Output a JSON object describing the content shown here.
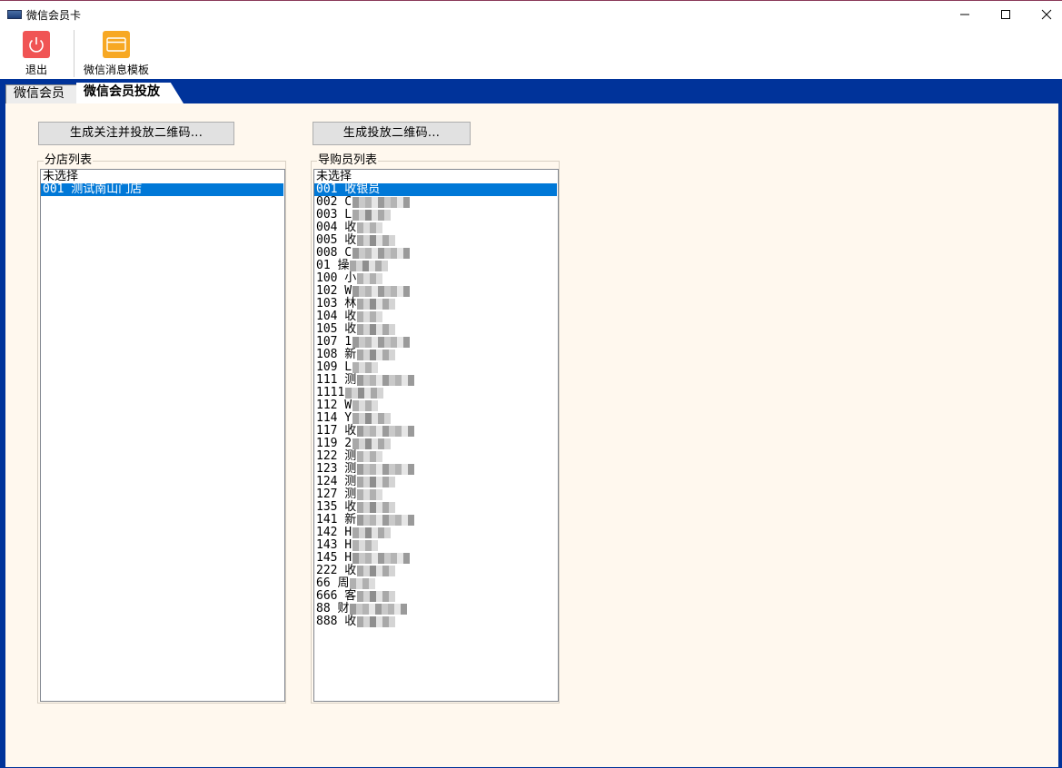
{
  "window": {
    "title": "微信会员卡"
  },
  "toolbar": {
    "exit_label": "退出",
    "template_label": "微信消息模板",
    "exit_color": "#f05454",
    "template_color": "#f7a823"
  },
  "tabs": [
    {
      "label": "微信会员",
      "active": false
    },
    {
      "label": "微信会员投放",
      "active": true
    }
  ],
  "buttons": {
    "follow_qr": "生成关注并投放二维码...",
    "deliver_qr": "生成投放二维码..."
  },
  "store_list": {
    "title": "分店列表",
    "items": [
      {
        "label": "未选择",
        "selected": false
      },
      {
        "label": "001 测试南山门店",
        "selected": true
      }
    ]
  },
  "clerk_list": {
    "title": "导购员列表",
    "items": [
      {
        "label": "未选择",
        "selected": false
      },
      {
        "label": "001 收银员",
        "selected": true
      },
      {
        "label": "002 C",
        "selected": false
      },
      {
        "label": "003 L",
        "selected": false
      },
      {
        "label": "004 收",
        "selected": false
      },
      {
        "label": "005 收",
        "selected": false
      },
      {
        "label": "008 C",
        "selected": false
      },
      {
        "label": "01 操",
        "selected": false
      },
      {
        "label": "100 小",
        "selected": false
      },
      {
        "label": "102 W",
        "selected": false
      },
      {
        "label": "103 林",
        "selected": false
      },
      {
        "label": "104 收",
        "selected": false
      },
      {
        "label": "105 收",
        "selected": false
      },
      {
        "label": "107 1",
        "selected": false
      },
      {
        "label": "108 新",
        "selected": false
      },
      {
        "label": "109 L",
        "selected": false
      },
      {
        "label": "111 测",
        "selected": false
      },
      {
        "label": "1111",
        "selected": false
      },
      {
        "label": "112 W",
        "selected": false
      },
      {
        "label": "114 Y",
        "selected": false
      },
      {
        "label": "117 收",
        "selected": false
      },
      {
        "label": "119 2",
        "selected": false
      },
      {
        "label": "122 测",
        "selected": false
      },
      {
        "label": "123 测",
        "selected": false
      },
      {
        "label": "124 测",
        "selected": false
      },
      {
        "label": "127 测",
        "selected": false
      },
      {
        "label": "135 收",
        "selected": false
      },
      {
        "label": "141 新",
        "selected": false
      },
      {
        "label": "142 H",
        "selected": false
      },
      {
        "label": "143 H",
        "selected": false
      },
      {
        "label": "145 H",
        "selected": false
      },
      {
        "label": "222 收",
        "selected": false
      },
      {
        "label": "66 周",
        "selected": false
      },
      {
        "label": "666 客",
        "selected": false
      },
      {
        "label": "88 财",
        "selected": false
      },
      {
        "label": "888 收",
        "selected": false
      }
    ]
  }
}
